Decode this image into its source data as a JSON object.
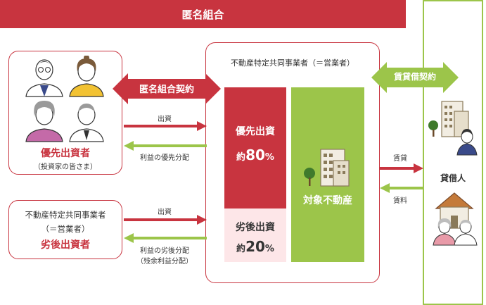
{
  "header": {
    "title": "匿名組合"
  },
  "investors_box": {
    "title": "優先出資者",
    "subtitle": "（投資家の皆さま）"
  },
  "operator_box": {
    "line1": "不動産特定共同事業者",
    "line2": "（＝営業者）",
    "title": "劣後出資者"
  },
  "main_box": {
    "title": "不動産特定共同事業者（＝営業者）",
    "priority_label": "優先出資",
    "priority_prefix": "約",
    "priority_pct": "80",
    "subordinate_label": "劣後出資",
    "subordinate_prefix": "約",
    "subordinate_pct": "20",
    "percent_sign": "%",
    "property_label": "対象不動産"
  },
  "arrows": {
    "tokumei_contract": "匿名組合契約",
    "lease_contract": "賃貸借契約",
    "investment_top": "出資",
    "priority_dist": "利益の優先分配",
    "investment_bottom": "出資",
    "subordinate_dist_1": "利益の劣後分配",
    "subordinate_dist_2": "（残余利益分配）",
    "lease": "賃貸",
    "rent": "賃料"
  },
  "tenant": {
    "label": "貸借人"
  },
  "colors": {
    "red": "#c8343f",
    "green": "#9cc54a",
    "pink": "#fde6e8"
  }
}
